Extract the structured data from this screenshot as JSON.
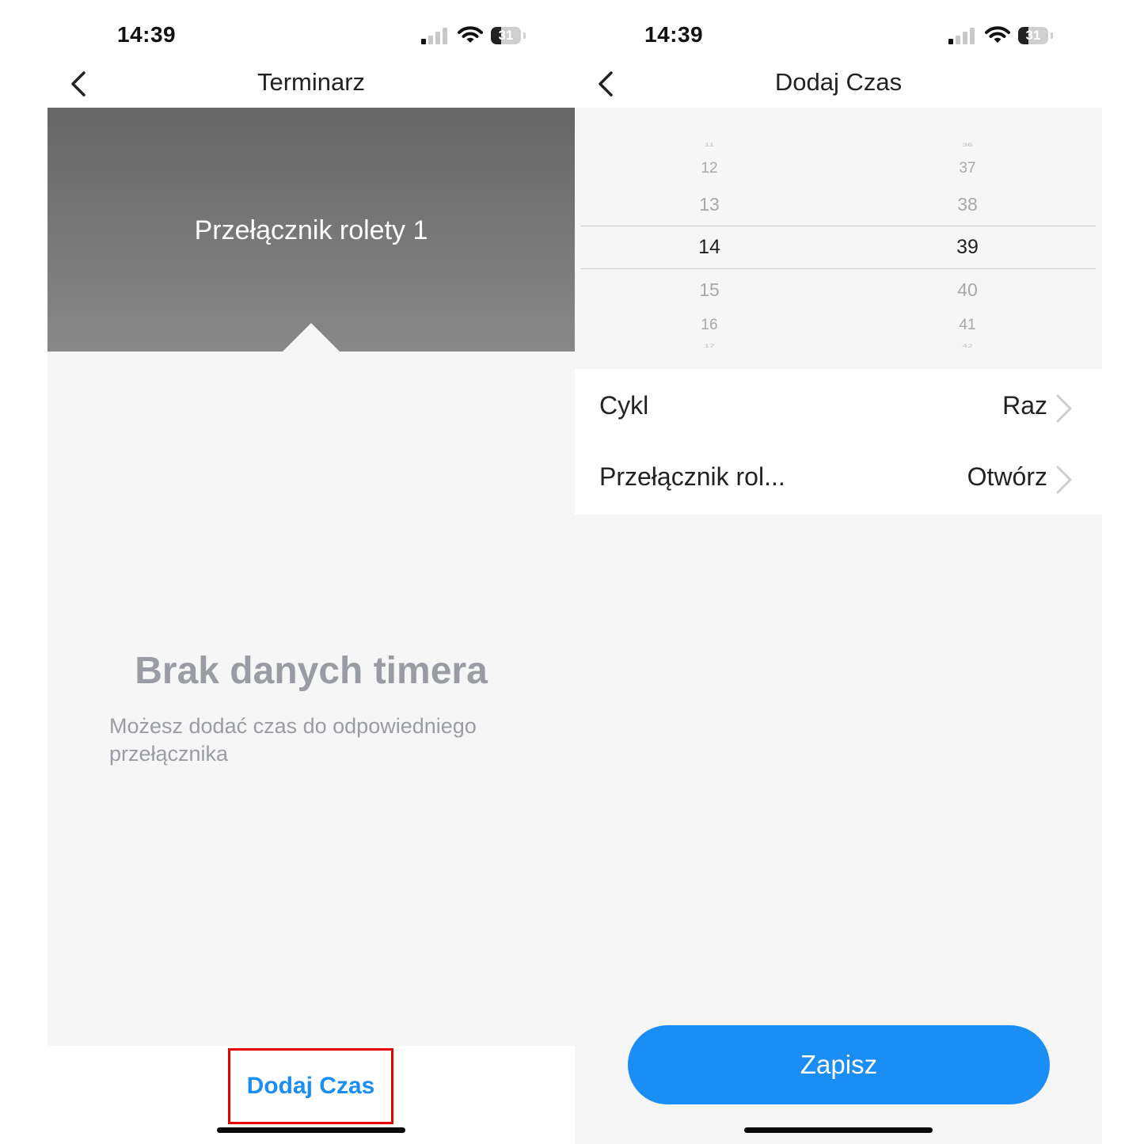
{
  "left_screen": {
    "status": {
      "time": "14:39",
      "battery": "31"
    },
    "nav": {
      "title": "Terminarz"
    },
    "hero": {
      "device_name": "Przełącznik rolety 1"
    },
    "empty_state": {
      "title": "Brak danych timera",
      "description": "Możesz dodać czas do odpowiedniego przełącznika"
    },
    "bottom": {
      "add_time_label": "Dodaj Czas"
    }
  },
  "right_screen": {
    "status": {
      "time": "14:39",
      "battery": "31"
    },
    "nav": {
      "title": "Dodaj Czas"
    },
    "picker": {
      "hours": [
        "11",
        "12",
        "13",
        "14",
        "15",
        "16",
        "17"
      ],
      "minutes": [
        "36",
        "37",
        "38",
        "39",
        "40",
        "41",
        "42"
      ],
      "selected_hour": "14",
      "selected_minute": "39"
    },
    "settings": [
      {
        "label": "Cykl",
        "value": "Raz"
      },
      {
        "label": "Przełącznik rol...",
        "value": "Otwórz"
      }
    ],
    "save_label": "Zapisz"
  },
  "colors": {
    "accent": "#1b8ef5",
    "highlight_border": "#e60000",
    "empty_text": "#9a9ca4",
    "hero_top": "#666666",
    "hero_bottom": "#888888"
  },
  "icons": {
    "back": "chevron-left-icon",
    "row_arrow": "chevron-right-icon",
    "signal": "cellular-signal-icon",
    "wifi": "wifi-icon",
    "battery": "battery-icon"
  }
}
